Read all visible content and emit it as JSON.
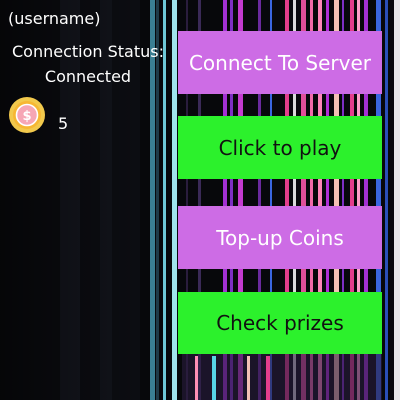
{
  "user": {
    "name": "(username)"
  },
  "connection": {
    "label": "Connection Status:",
    "status": "Connected"
  },
  "wallet": {
    "icon": "dollar-coin-icon",
    "coin_symbol": "$",
    "coins": "5"
  },
  "buttons": {
    "connect": {
      "label": "Connect To Server",
      "bg": "#cd6ce5",
      "fg": "#ffffff"
    },
    "play": {
      "label": "Click to play",
      "bg": "#2cf12c",
      "fg": "#111111"
    },
    "topup": {
      "label": "Top-up Coins",
      "bg": "#cd6ce5",
      "fg": "#ffffff"
    },
    "prizes": {
      "label": "Check prizes",
      "bg": "#2cf12c",
      "fg": "#111111"
    }
  },
  "theme": {
    "background": "#07080b",
    "stripe_colors": [
      "#58d3e6",
      "#7e2fc4",
      "#e33e8c",
      "#b12fd6",
      "#3a66e0",
      "#f3c0b4",
      "#ffffff"
    ]
  }
}
